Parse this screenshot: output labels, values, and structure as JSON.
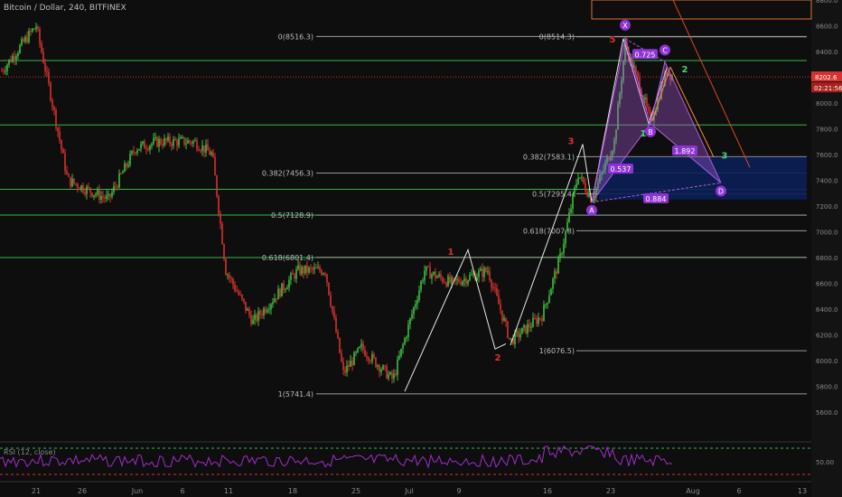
{
  "header": {
    "title": "Bitcoin / Dollar, 240, BITFINEX"
  },
  "rsi": {
    "label": "RSI (12, close)"
  },
  "colors": {
    "background": "#0e0e0e",
    "up": "#3fbf3f",
    "down": "#d9322e",
    "fib_line": "#9a9a9a",
    "green_line": "#38b54a",
    "pattern": "#b05be0",
    "orange": "#ff8b2f",
    "label_bg": "#8e33d6"
  },
  "chart_data": {
    "type": "candlestick",
    "title": "Bitcoin / Dollar, 240, BITFINEX",
    "ylim": [
      5600,
      8800
    ],
    "x_tick_labels": [
      "21",
      "26",
      "Jun",
      "6",
      "11",
      "18",
      "25",
      "Jul",
      "9",
      "16",
      "23",
      "Aug",
      "6",
      "13"
    ],
    "y_tick_labels": [
      "5600.0",
      "5800.0",
      "6000.0",
      "6200.0",
      "6400.0",
      "6600.0",
      "6800.0",
      "7000.0",
      "7200.0",
      "7400.0",
      "7600.0",
      "7800.0",
      "8000.0",
      "8200.0",
      "8400.0",
      "8600.0",
      "8800.0"
    ],
    "price_now": "8202.6",
    "countdown": "02:21:56",
    "fib_levels_left": [
      {
        "label": "0(8516.3)",
        "price": 8516.3
      },
      {
        "label": "0.382(7456.3)",
        "price": 7456.3
      },
      {
        "label": "0.5(7128.9)",
        "price": 7128.9
      },
      {
        "label": "0.618(6801.4)",
        "price": 6801.4
      },
      {
        "label": "1(5741.4)",
        "price": 5741.4
      }
    ],
    "fib_levels_right": [
      {
        "label": "0(8514.3)",
        "price": 8514.3
      },
      {
        "label": "0.382(7583.1)",
        "price": 7583.1
      },
      {
        "label": "0.5(7295.4)",
        "price": 7295.4
      },
      {
        "label": "0.618(7007.8)",
        "price": 7007.8
      },
      {
        "label": "1(6076.5)",
        "price": 6076.5
      }
    ],
    "pattern_points": [
      "X",
      "A",
      "B",
      "C",
      "D"
    ],
    "pattern_ratios": [
      "0.725",
      "0.537",
      "1.892",
      "0.884"
    ],
    "waves": [
      "1",
      "2",
      "3",
      "5",
      "1",
      "2",
      "3"
    ],
    "rsi_levels": [
      "50.00"
    ]
  }
}
